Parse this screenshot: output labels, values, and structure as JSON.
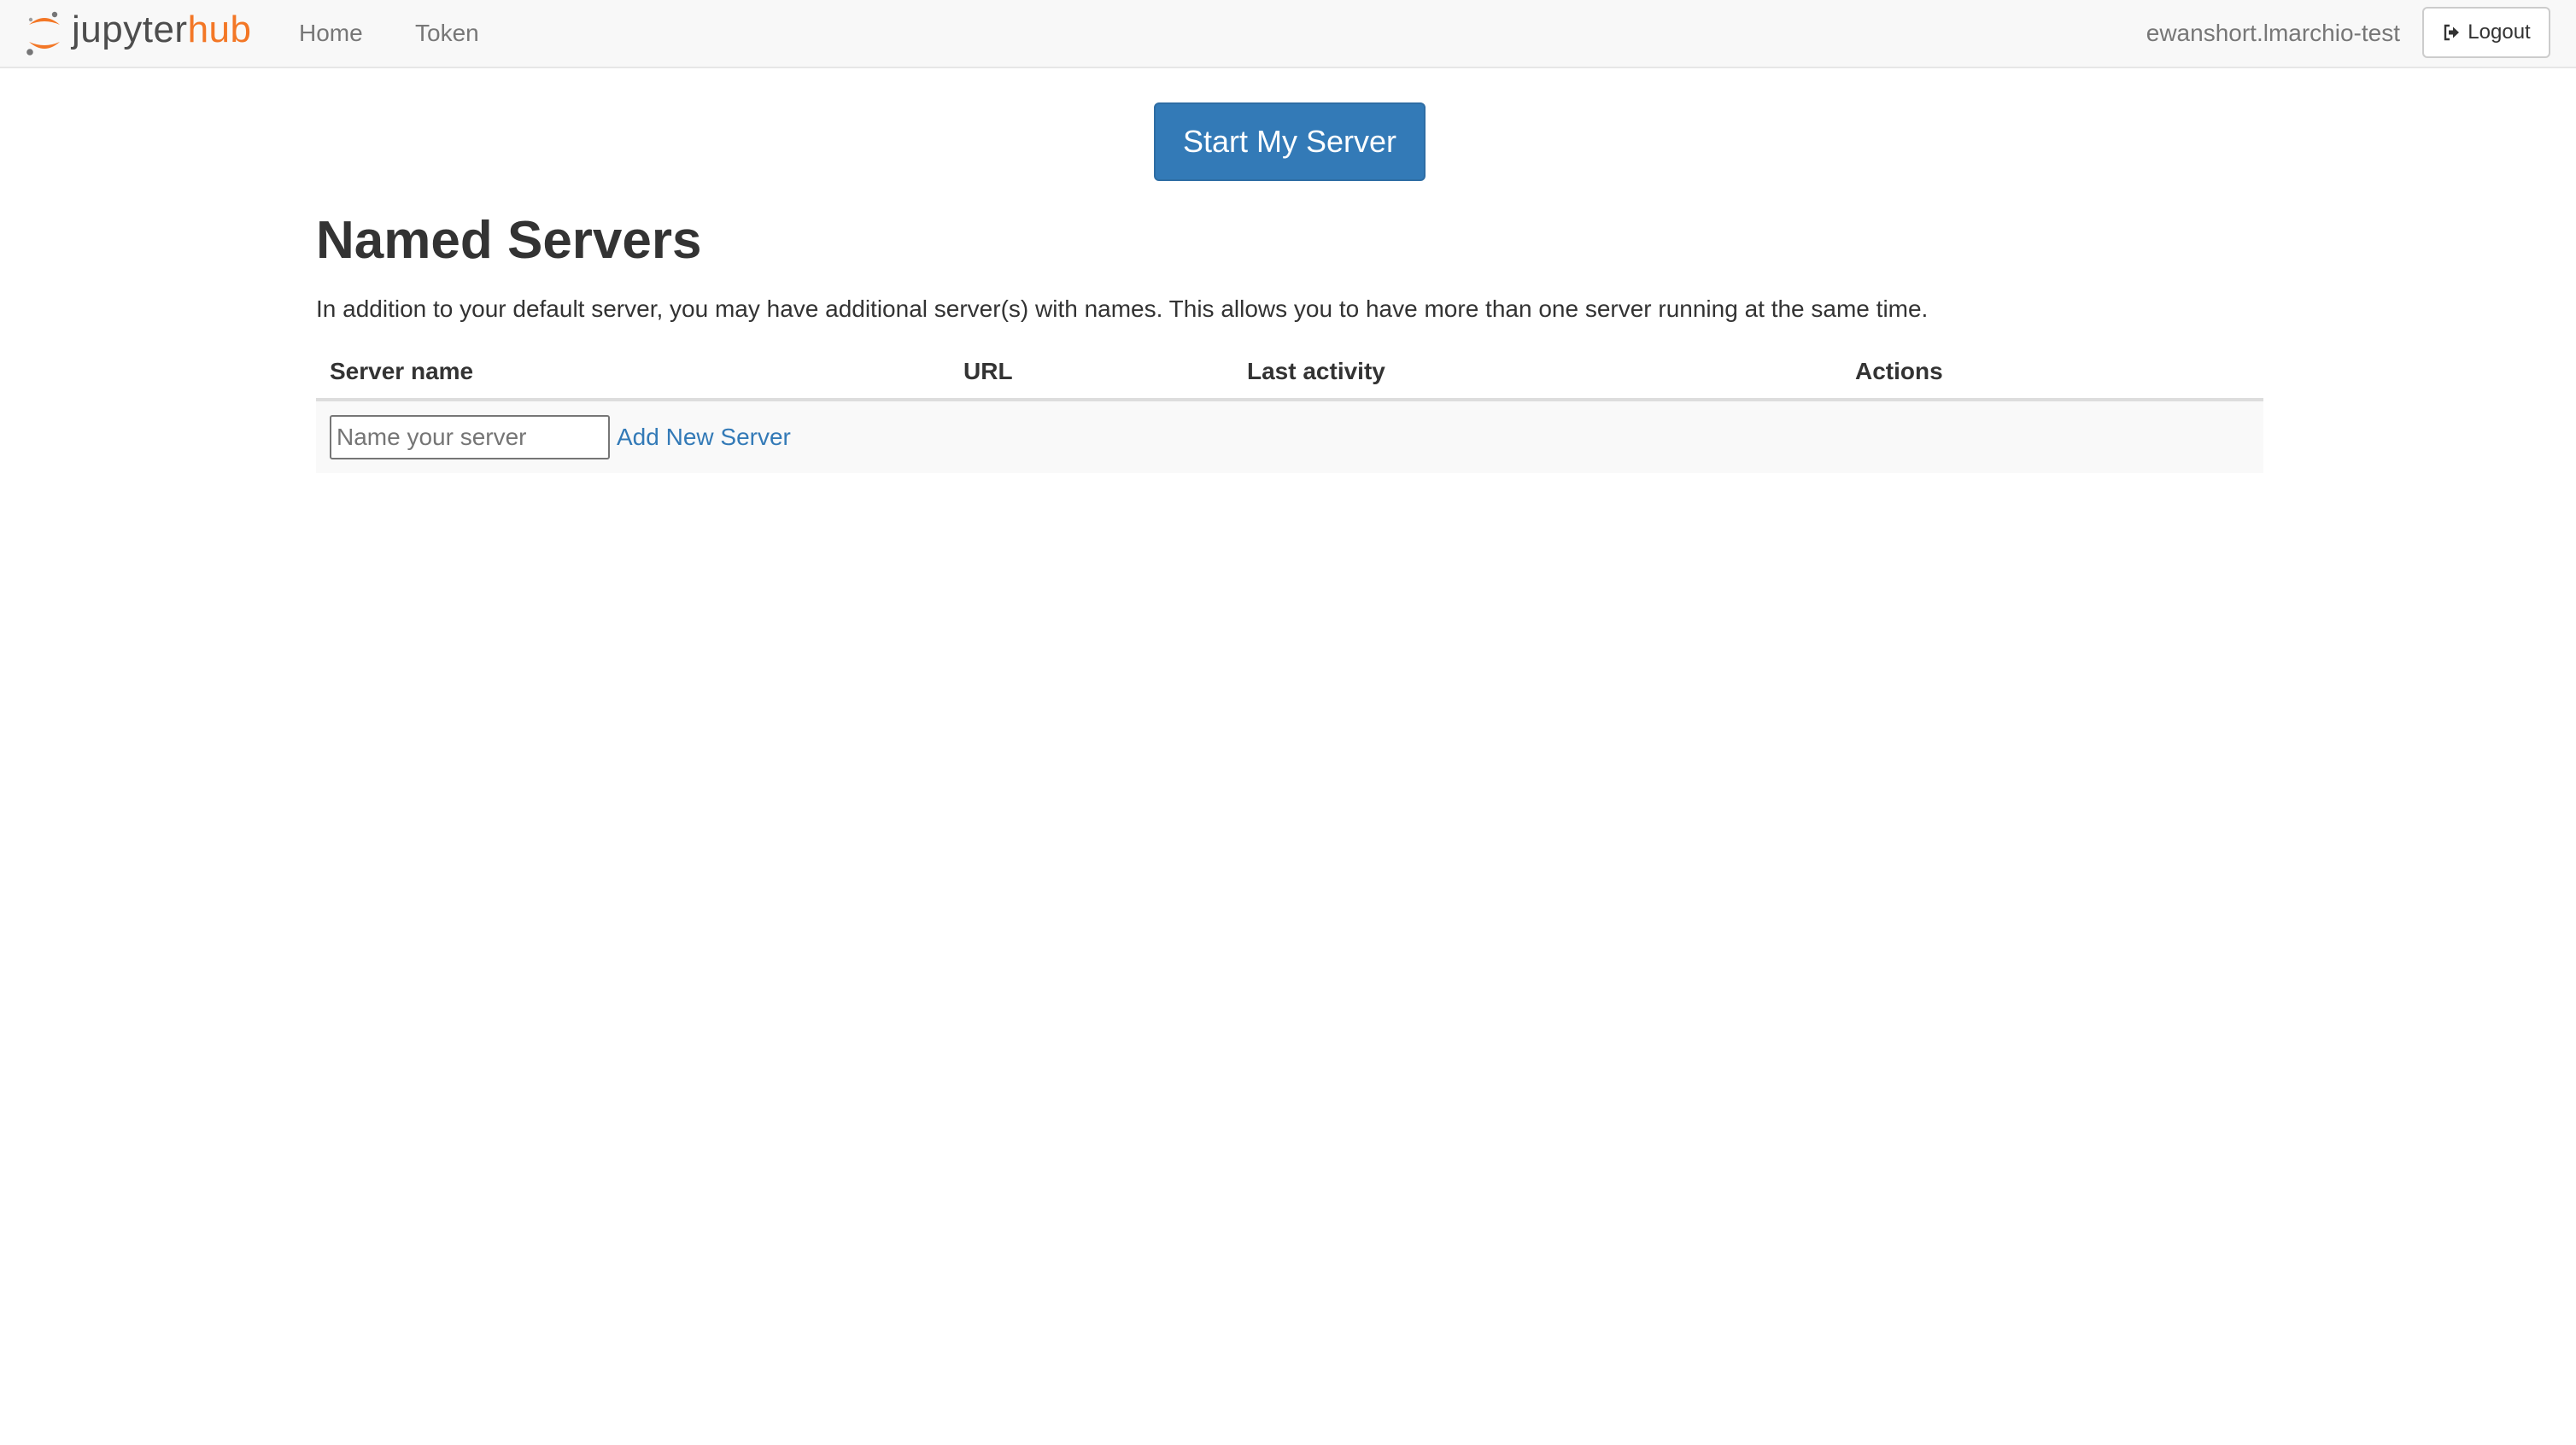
{
  "brand": {
    "name_part1": "jupyter",
    "name_part2": "hub",
    "logo_icon": "jupyter-logo-icon",
    "accent_color": "#f37726"
  },
  "nav": {
    "home_label": "Home",
    "token_label": "Token"
  },
  "user": {
    "name": "ewanshort.lmarchio-test",
    "logout_label": "Logout",
    "logout_icon": "sign-out-icon"
  },
  "start_server": {
    "label": "Start My Server",
    "color": "#337ab7"
  },
  "named_servers": {
    "title": "Named Servers",
    "description": "In addition to your default server, you may have additional server(s) with names. This allows you to have more than one server running at the same time.",
    "columns": [
      "Server name",
      "URL",
      "Last activity",
      "Actions"
    ],
    "new_server": {
      "input_value": "",
      "input_placeholder": "Name your server",
      "add_label": "Add New Server"
    }
  }
}
